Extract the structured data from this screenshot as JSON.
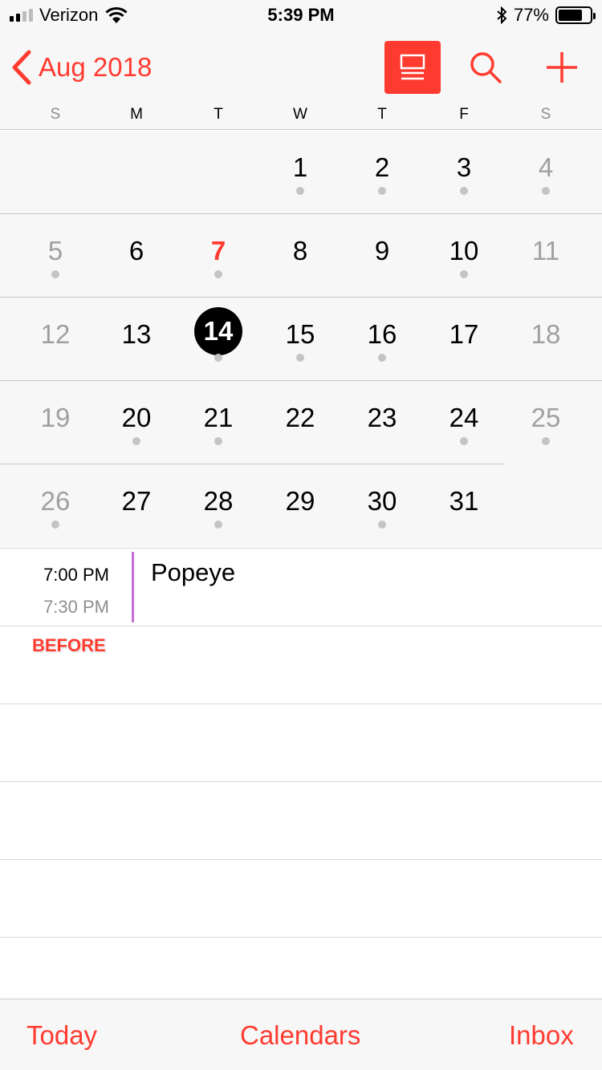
{
  "status_bar": {
    "carrier": "Verizon",
    "time": "5:39 PM",
    "battery_percent": "77%",
    "battery_level": 0.77,
    "signal_bars": 4,
    "signal_active": 2
  },
  "nav": {
    "back_label": "Aug 2018",
    "accent_color": "#ff3b30",
    "icons": [
      "chevron-left-icon",
      "list-view-icon",
      "search-icon",
      "plus-icon"
    ]
  },
  "weekdays": [
    "S",
    "M",
    "T",
    "W",
    "T",
    "F",
    "S"
  ],
  "month": {
    "weeks": [
      [
        {
          "n": ""
        },
        {
          "n": ""
        },
        {
          "n": ""
        },
        {
          "n": "1",
          "dot": true
        },
        {
          "n": "2",
          "dot": true
        },
        {
          "n": "3",
          "dot": true
        },
        {
          "n": "4",
          "dot": true,
          "weekend": true
        }
      ],
      [
        {
          "n": "5",
          "dot": true,
          "weekend": true
        },
        {
          "n": "6"
        },
        {
          "n": "7",
          "dot": true,
          "today": true
        },
        {
          "n": "8"
        },
        {
          "n": "9"
        },
        {
          "n": "10",
          "dot": true
        },
        {
          "n": "11",
          "weekend": true
        }
      ],
      [
        {
          "n": "12",
          "weekend": true
        },
        {
          "n": "13"
        },
        {
          "n": "14",
          "dot": true,
          "selected": true
        },
        {
          "n": "15",
          "dot": true
        },
        {
          "n": "16",
          "dot": true
        },
        {
          "n": "17"
        },
        {
          "n": "18",
          "weekend": true
        }
      ],
      [
        {
          "n": "19",
          "weekend": true
        },
        {
          "n": "20",
          "dot": true
        },
        {
          "n": "21",
          "dot": true
        },
        {
          "n": "22"
        },
        {
          "n": "23"
        },
        {
          "n": "24",
          "dot": true
        },
        {
          "n": "25",
          "dot": true,
          "weekend": true
        }
      ],
      [
        {
          "n": "26",
          "dot": true,
          "weekend": true
        },
        {
          "n": "27"
        },
        {
          "n": "28",
          "dot": true
        },
        {
          "n": "29"
        },
        {
          "n": "30",
          "dot": true
        },
        {
          "n": "31"
        },
        {
          "n": ""
        }
      ]
    ]
  },
  "event": {
    "start": "7:00 PM",
    "end": "7:30 PM",
    "title": "Popeye",
    "color": "#c86dd7"
  },
  "overlay_label": "BEFORE",
  "tabs": [
    "Today",
    "Calendars",
    "Inbox"
  ]
}
